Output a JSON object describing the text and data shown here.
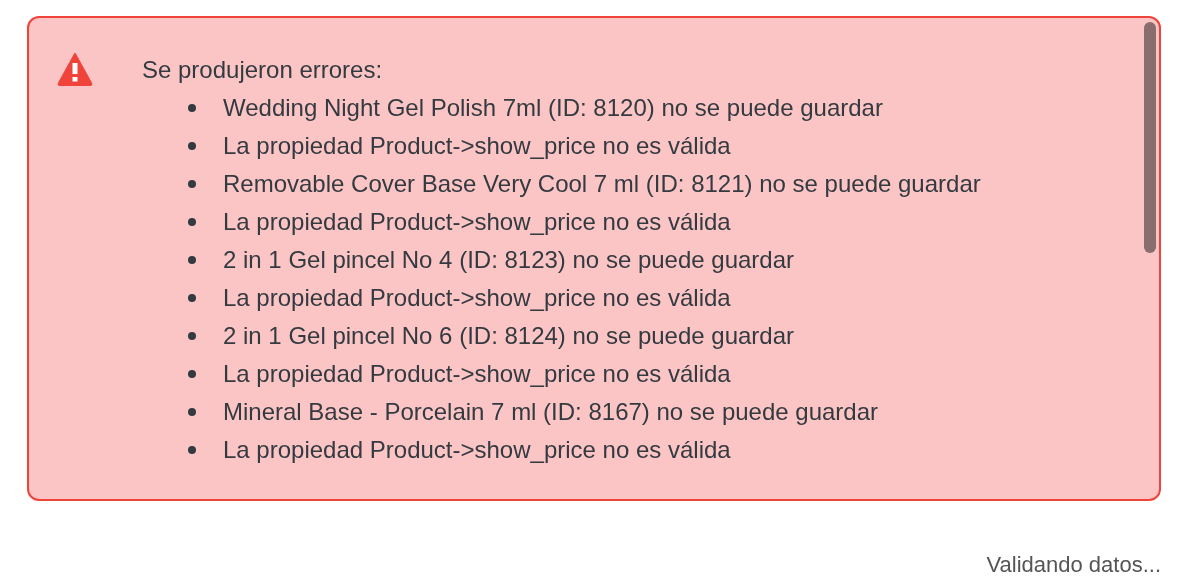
{
  "alert": {
    "title": "Se produjeron errores:",
    "messages": [
      "Wedding Night Gel Polish 7ml (ID: 8120) no se puede guardar",
      "La propiedad Product->show_price no es válida",
      "Removable Cover Base Very Cool 7 ml (ID: 8121) no se puede guardar",
      "La propiedad Product->show_price no es válida",
      "2 in 1 Gel pincel No 4 (ID: 8123) no se puede guardar",
      "La propiedad Product->show_price no es válida",
      "2 in 1 Gel pincel No 6 (ID: 8124) no se puede guardar",
      "La propiedad Product->show_price no es válida",
      "Mineral Base - Porcelain 7 ml (ID: 8167) no se puede guardar",
      "La propiedad Product->show_price no es válida"
    ]
  },
  "status": "Validando datos..."
}
